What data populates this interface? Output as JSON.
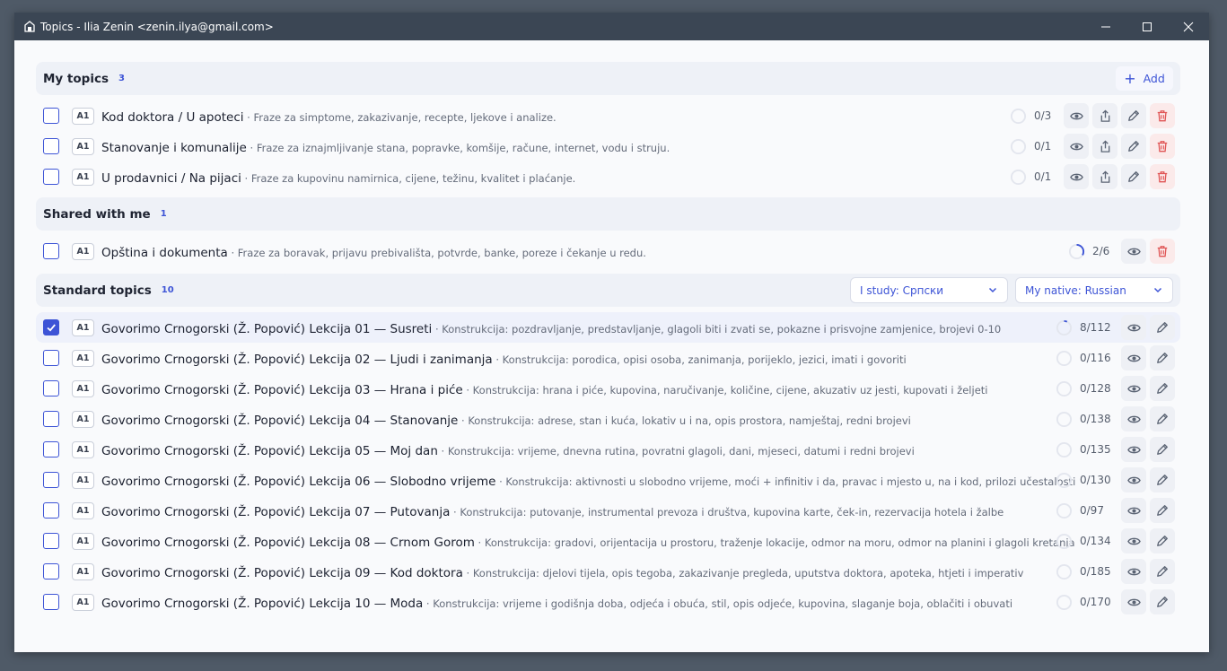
{
  "window": {
    "title": "Topics - Ilia Zenin <zenin.ilya@gmail.com>",
    "controls": [
      "minimize-icon",
      "maximize-icon",
      "close-icon"
    ]
  },
  "colors": {
    "accent": "#3d54d6",
    "danger": "#e05555",
    "titlebar": "#3b4654"
  },
  "my_topics": {
    "title": "My topics",
    "count": "3",
    "add_label": "Add",
    "items": [
      {
        "level": "A1",
        "name": "Kod doktora / U apoteci",
        "desc": " · Fraze za simptome, zakazivanje, recepte, ljekove i analize.",
        "progress": "0/3",
        "fraction": 0
      },
      {
        "level": "A1",
        "name": "Stanovanje i komunalije",
        "desc": " · Fraze za iznajmljivanje stana, popravke, komšije, račune, internet, vodu i struju.",
        "progress": "0/1",
        "fraction": 0
      },
      {
        "level": "A1",
        "name": "U prodavnici / Na pijaci",
        "desc": " · Fraze za kupovinu namirnica, cijene, težinu, kvalitet i plaćanje.",
        "progress": "0/1",
        "fraction": 0
      }
    ]
  },
  "shared": {
    "title": "Shared with me",
    "count": "1",
    "items": [
      {
        "level": "A1",
        "name": "Opština i dokumenta",
        "desc": " · Fraze za boravak, prijavu prebivališta, potvrde, banke, poreze i čekanje u redu.",
        "progress": "2/6",
        "fraction": 0.333
      }
    ]
  },
  "standard": {
    "title": "Standard topics",
    "count": "10",
    "study_select": "I study: Српски",
    "native_select": "My native: Russian",
    "items": [
      {
        "level": "A1",
        "checked": true,
        "name": "Govorimo Crnogorski (Ž. Popović) Lekcija 01 — Susreti",
        "desc": " · Konstrukcija: pozdravljanje, predstavljanje, glagoli biti i zvati se, pokazne i prisvojne zamjenice, brojevi 0-10",
        "progress": "8/112",
        "fraction": 0.071
      },
      {
        "level": "A1",
        "checked": false,
        "name": "Govorimo Crnogorski (Ž. Popović) Lekcija 02 — Ljudi i zanimanja",
        "desc": " · Konstrukcija: porodica, opisi osoba, zanimanja, porijeklo, jezici, imati i govoriti",
        "progress": "0/116",
        "fraction": 0
      },
      {
        "level": "A1",
        "checked": false,
        "name": "Govorimo Crnogorski (Ž. Popović) Lekcija 03 — Hrana i piće",
        "desc": " · Konstrukcija: hrana i piće, kupovina, naručivanje, količine, cijene, akuzativ uz jesti, kupovati i željeti",
        "progress": "0/128",
        "fraction": 0
      },
      {
        "level": "A1",
        "checked": false,
        "name": "Govorimo Crnogorski (Ž. Popović) Lekcija 04 — Stanovanje",
        "desc": " · Konstrukcija: adrese, stan i kuća, lokativ u i na, opis prostora, namještaj, redni brojevi",
        "progress": "0/138",
        "fraction": 0
      },
      {
        "level": "A1",
        "checked": false,
        "name": "Govorimo Crnogorski (Ž. Popović) Lekcija 05 — Moj dan",
        "desc": " · Konstrukcija: vrijeme, dnevna rutina, povratni glagoli, dani, mjeseci, datumi i redni brojevi",
        "progress": "0/135",
        "fraction": 0
      },
      {
        "level": "A1",
        "checked": false,
        "name": "Govorimo Crnogorski (Ž. Popović) Lekcija 06 — Slobodno vrijeme",
        "desc": " · Konstrukcija: aktivnosti u slobodno vrijeme, moći + infinitiv i da, pravac i mjesto u, na i kod, prilozi učestalosti",
        "progress": "0/130",
        "fraction": 0
      },
      {
        "level": "A1",
        "checked": false,
        "name": "Govorimo Crnogorski (Ž. Popović) Lekcija 07 — Putovanja",
        "desc": " · Konstrukcija: putovanje, instrumental prevoza i društva, kupovina karte, ček-in, rezervacija hotela i žalbe",
        "progress": "0/97",
        "fraction": 0
      },
      {
        "level": "A1",
        "checked": false,
        "name": "Govorimo Crnogorski (Ž. Popović) Lekcija 08 — Crnom Gorom",
        "desc": " · Konstrukcija: gradovi, orijentacija u prostoru, traženje lokacije, odmor na moru, odmor na planini i glagoli kretanja",
        "progress": "0/134",
        "fraction": 0
      },
      {
        "level": "A1",
        "checked": false,
        "name": "Govorimo Crnogorski (Ž. Popović) Lekcija 09 — Kod doktora",
        "desc": " · Konstrukcija: djelovi tijela, opis tegoba, zakazivanje pregleda, uputstva doktora, apoteka, htjeti i imperativ",
        "progress": "0/185",
        "fraction": 0
      },
      {
        "level": "A1",
        "checked": false,
        "name": "Govorimo Crnogorski (Ž. Popović) Lekcija 10 — Moda",
        "desc": " · Konstrukcija: vrijeme i godišnja doba, odjeća i obuća, stil, opis odjeće, kupovina, slaganje boja, oblačiti i obuvati",
        "progress": "0/170",
        "fraction": 0
      }
    ]
  }
}
